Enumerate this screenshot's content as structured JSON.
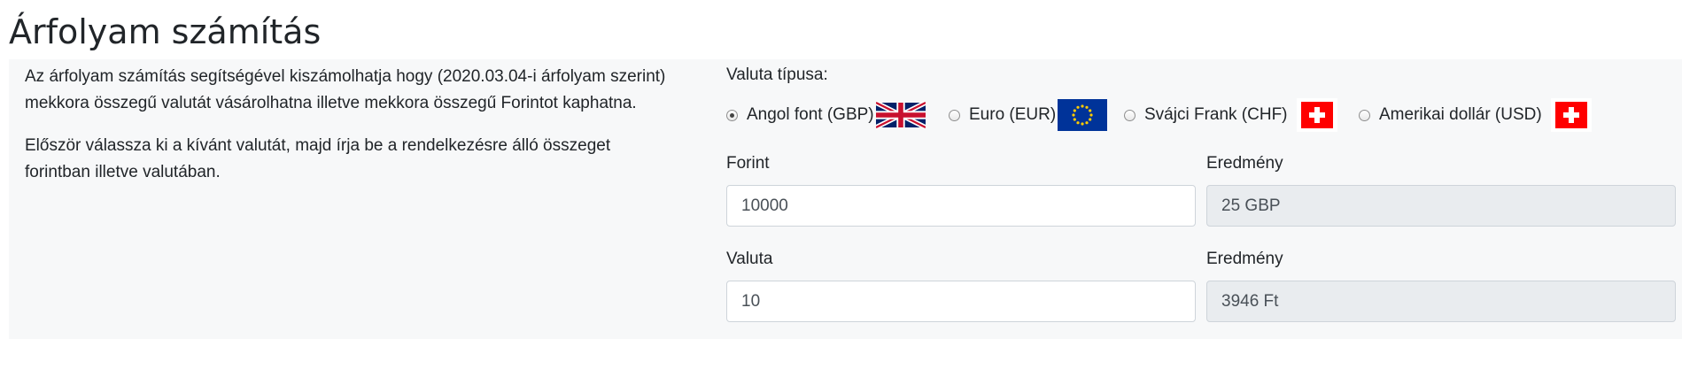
{
  "page": {
    "title": "Árfolyam számítás"
  },
  "intro": {
    "paragraph1": "Az árfolyam számítás segítségével kiszámolhatja hogy (2020.03.04-i árfolyam szerint) mekkora összegű valutát vásárolhatna illetve mekkora összegű Forintot kaphatna.",
    "paragraph2": "Először válassza ki a kívánt valutát, majd írja be a rendelkezésre álló összeget forintban illetve valutában."
  },
  "currency": {
    "label": "Valuta típusa:",
    "options": [
      {
        "label": "Angol font (GBP)",
        "checked": true,
        "flag_icon": "uk-flag-icon"
      },
      {
        "label": "Euro (EUR)",
        "checked": false,
        "flag_icon": "eu-flag-icon"
      },
      {
        "label": "Svájci Frank (CHF)",
        "checked": false,
        "flag_icon": "swiss-flag-icon"
      },
      {
        "label": "Amerikai dollár (USD)",
        "checked": false,
        "flag_icon": "swiss-flag-icon"
      }
    ]
  },
  "forint": {
    "label": "Forint",
    "value": "10000",
    "result_label": "Eredmény",
    "result_value": "25 GBP"
  },
  "valuta": {
    "label": "Valuta",
    "value": "10",
    "result_label": "Eredmény",
    "result_value": "3946 Ft"
  },
  "colors": {
    "panel_bg": "#f7f8f9",
    "readonly_bg": "#e9ecef",
    "input_border": "#ced4da",
    "text": "#212529"
  }
}
